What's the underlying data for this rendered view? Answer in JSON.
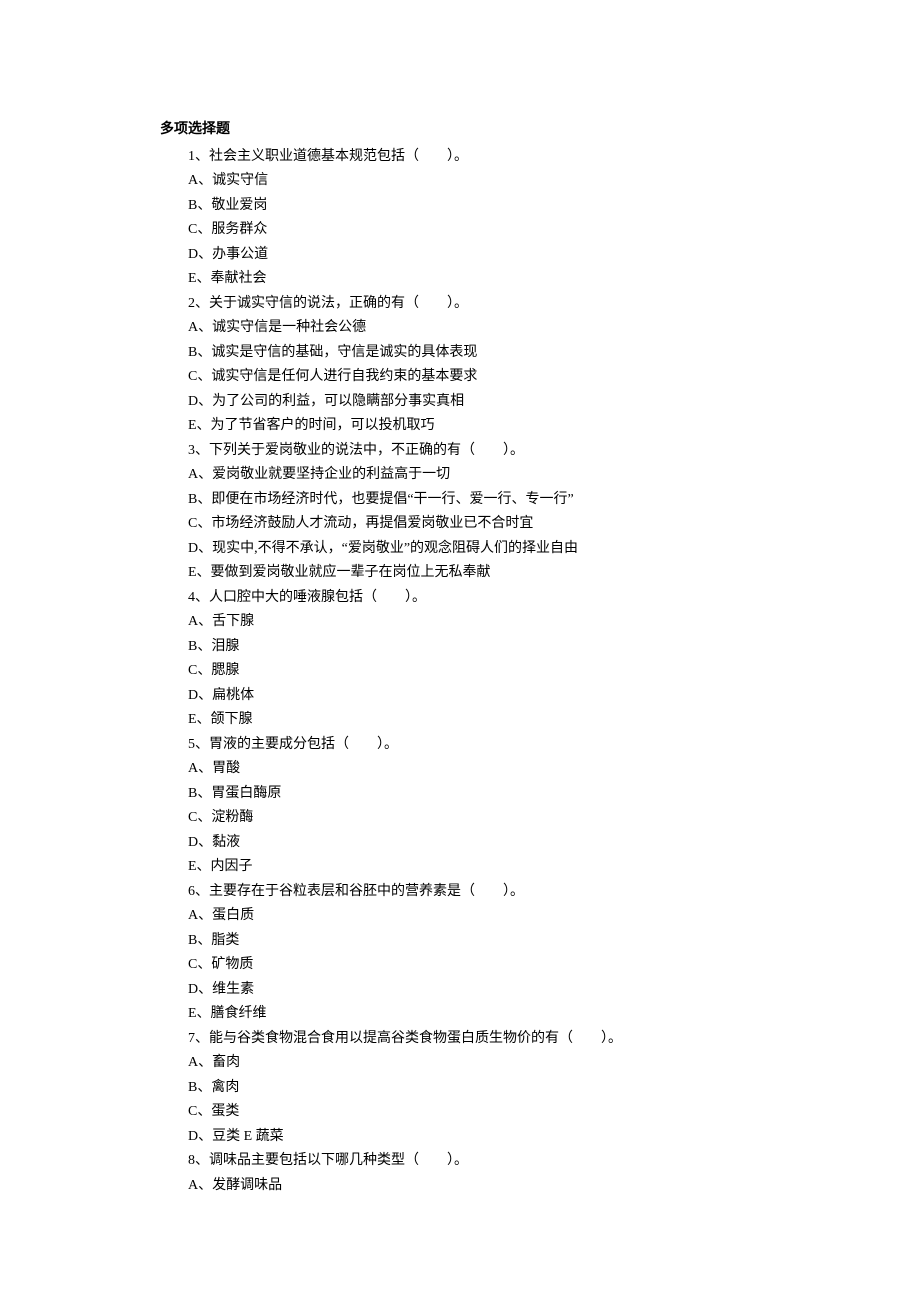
{
  "section_title": "多项选择题",
  "questions": [
    {
      "stem": "1、社会主义职业道德基本规范包括（　　）。",
      "options": [
        "A、诚实守信",
        "B、敬业爱岗",
        "C、服务群众",
        "D、办事公道",
        "E、奉献社会"
      ]
    },
    {
      "stem": "2、关于诚实守信的说法，正确的有（　　）。",
      "options": [
        "A、诚实守信是一种社会公德",
        "B、诚实是守信的基础，守信是诚实的具体表现",
        "C、诚实守信是任何人进行自我约束的基本要求",
        "D、为了公司的利益，可以隐瞒部分事实真相",
        "E、为了节省客户的时间，可以投机取巧"
      ]
    },
    {
      "stem": "3、下列关于爱岗敬业的说法中，不正确的有（　　）。",
      "options": [
        "A、爱岗敬业就要坚持企业的利益高于一切",
        "B、即便在市场经济时代，也要提倡“干一行、爱一行、专一行”",
        "C、市场经济鼓励人才流动，再提倡爱岗敬业已不合时宜",
        "D、现实中,不得不承认，“爱岗敬业”的观念阻碍人们的择业自由",
        "E、要做到爱岗敬业就应一辈子在岗位上无私奉献"
      ]
    },
    {
      "stem": "4、人口腔中大的唾液腺包括（　　）。",
      "options": [
        "A、舌下腺",
        "B、泪腺",
        "C、腮腺",
        "D、扁桃体",
        "E、颌下腺"
      ]
    },
    {
      "stem": "5、胃液的主要成分包括（　　）。",
      "options": [
        "A、胃酸",
        "B、胃蛋白酶原",
        "C、淀粉酶",
        "D、黏液",
        "E、内因子"
      ]
    },
    {
      "stem": "6、主要存在于谷粒表层和谷胚中的营养素是（　　）。",
      "options": [
        "A、蛋白质",
        "B、脂类",
        "C、矿物质",
        "D、维生素",
        "E、膳食纤维"
      ]
    },
    {
      "stem": "7、能与谷类食物混合食用以提高谷类食物蛋白质生物价的有（　　）。",
      "options": [
        "A、畜肉",
        "B、禽肉",
        "C、蛋类",
        "D、豆类 E 蔬菜"
      ]
    },
    {
      "stem": "8、调味品主要包括以下哪几种类型（　　）。",
      "options": [
        "A、发酵调味品"
      ]
    }
  ]
}
